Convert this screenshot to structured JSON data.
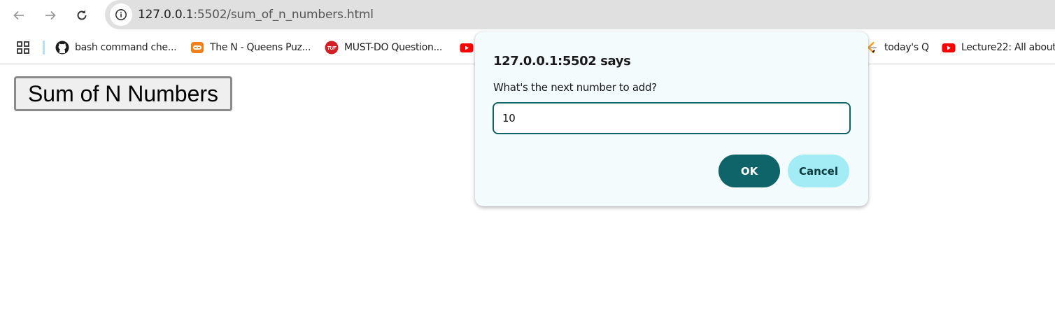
{
  "browser": {
    "url_host": "127.0.0.1",
    "url_rest": ":5502/sum_of_n_numbers.html"
  },
  "bookmarks": [
    {
      "label": "bash command che...",
      "icon": "github-icon"
    },
    {
      "label": "The N - Queens Puz...",
      "icon": "codingninjas-icon"
    },
    {
      "label": "MUST-DO Question...",
      "icon": "tuf-icon"
    },
    {
      "label": "",
      "icon": "youtube-icon"
    },
    {
      "label": "today's Q",
      "icon": "leetcode-icon"
    },
    {
      "label": "Lecture22: All about...",
      "icon": "youtube-icon"
    }
  ],
  "page": {
    "button_label": "Sum of N Numbers"
  },
  "dialog": {
    "title": "127.0.0.1:5502 says",
    "message": "What's the next number to add?",
    "input_value": "10",
    "ok_label": "OK",
    "cancel_label": "Cancel"
  },
  "colors": {
    "dialog_accent": "#0e6469",
    "cancel_bg": "#a3ebf5",
    "omnibox_bg": "#e0e0e0"
  }
}
